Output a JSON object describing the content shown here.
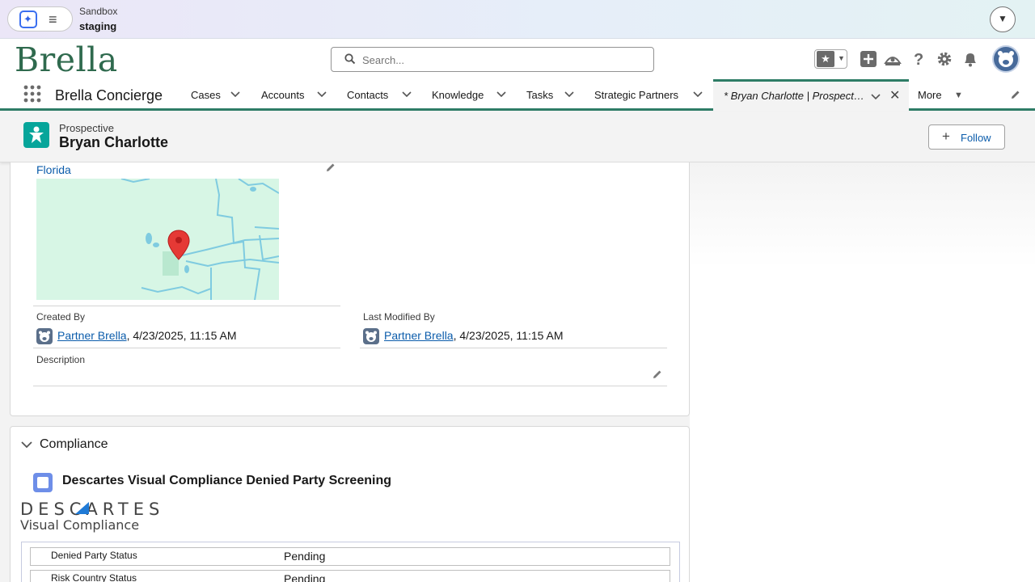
{
  "sandbox": {
    "label": "Sandbox",
    "name": "staging"
  },
  "header": {
    "logo_text": "Brella",
    "search_placeholder": "Search..."
  },
  "nav": {
    "app_name": "Brella Concierge",
    "items": [
      {
        "label": "Cases"
      },
      {
        "label": "Accounts"
      },
      {
        "label": "Contacts"
      },
      {
        "label": "Knowledge"
      },
      {
        "label": "Tasks"
      },
      {
        "label": "Strategic Partners"
      }
    ],
    "active_tab": "* Bryan Charlotte | Prospective",
    "more_label": "More"
  },
  "record": {
    "type": "Prospective",
    "name": "Bryan Charlotte",
    "follow_label": "Follow"
  },
  "details": {
    "address_link": "Florida",
    "created_by": {
      "label": "Created By",
      "user": "Partner Brella",
      "timestamp": ", 4/23/2025, 11:15 AM"
    },
    "last_modified_by": {
      "label": "Last Modified By",
      "user": "Partner Brella",
      "timestamp": ", 4/23/2025, 11:15 AM"
    },
    "description": {
      "label": "Description",
      "value": ""
    }
  },
  "compliance": {
    "section_title": "Compliance",
    "component_title": "Descartes Visual Compliance Denied Party Screening",
    "logo_top": "DESCARTES",
    "logo_sub": "Visual Compliance",
    "rows": [
      {
        "label": "Denied Party Status",
        "value": "Pending"
      },
      {
        "label": "Risk Country Status",
        "value": "Pending"
      }
    ]
  },
  "colors": {
    "brand_green": "#2e7c66",
    "link_blue": "#0b5cab",
    "record_icon": "#06a59a"
  }
}
